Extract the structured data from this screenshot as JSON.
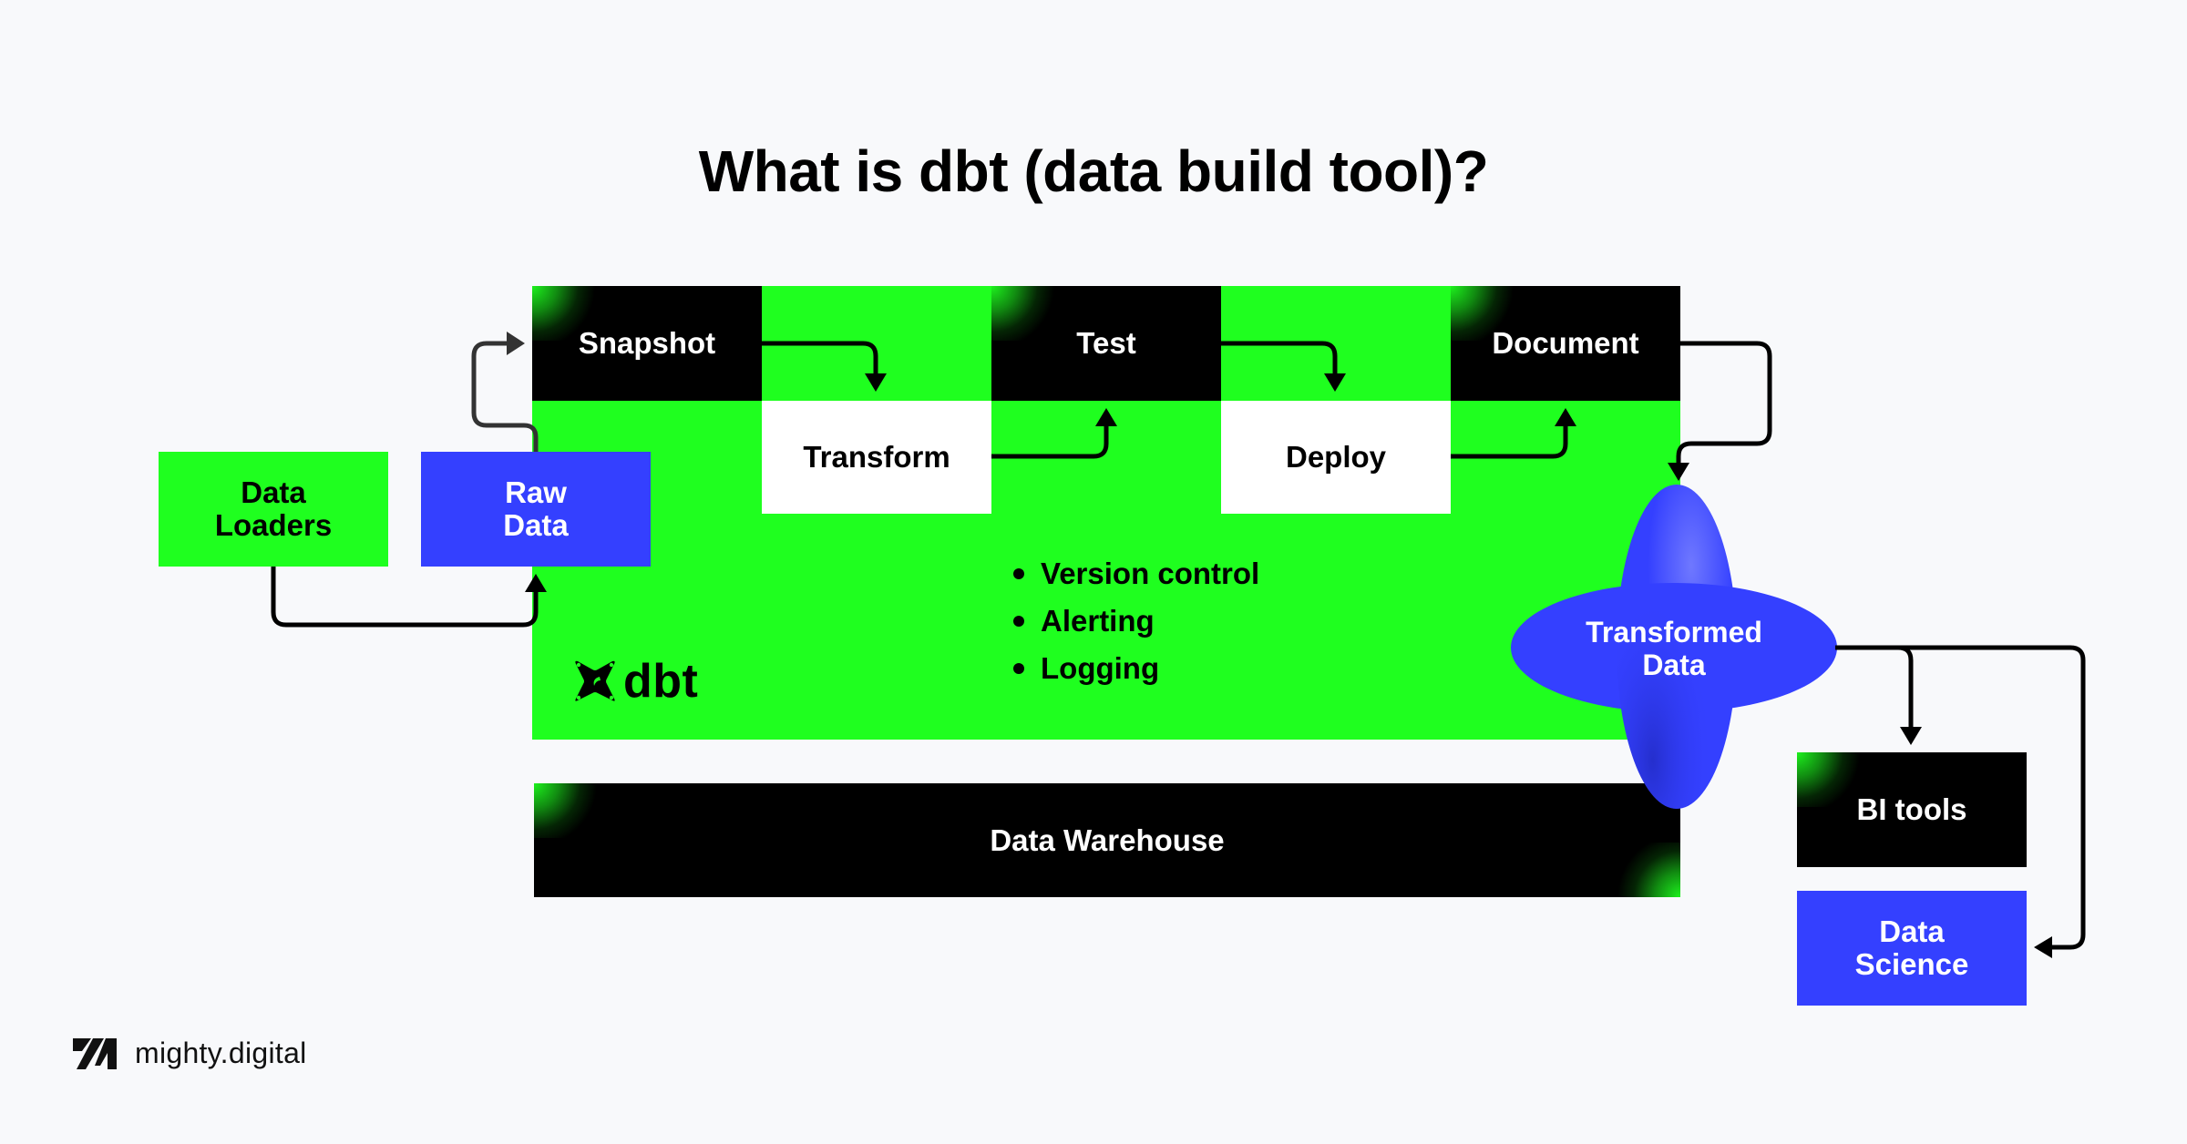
{
  "title": "What is dbt (data build tool)?",
  "nodes": {
    "data_loaders": "Data\nLoaders",
    "raw_data": "Raw\nData",
    "snapshot": "Snapshot",
    "transform": "Transform",
    "test": "Test",
    "deploy": "Deploy",
    "document": "Document",
    "transformed_data": "Transformed\nData",
    "data_warehouse": "Data Warehouse",
    "bi_tools": "BI tools",
    "data_science": "Data\nScience"
  },
  "dbt_panel": {
    "logo_text": "dbt",
    "logo_icon": "dbt-logo-icon",
    "features": [
      "Version control",
      "Alerting",
      "Logging"
    ]
  },
  "footer": {
    "brand": "mighty.digital",
    "logo_icon": "mighty-digital-logo-icon"
  },
  "colors": {
    "green": "#1FFF1F",
    "blue": "#3440FF",
    "black": "#000000",
    "white": "#FFFFFF",
    "background": "#F8F9FB"
  }
}
